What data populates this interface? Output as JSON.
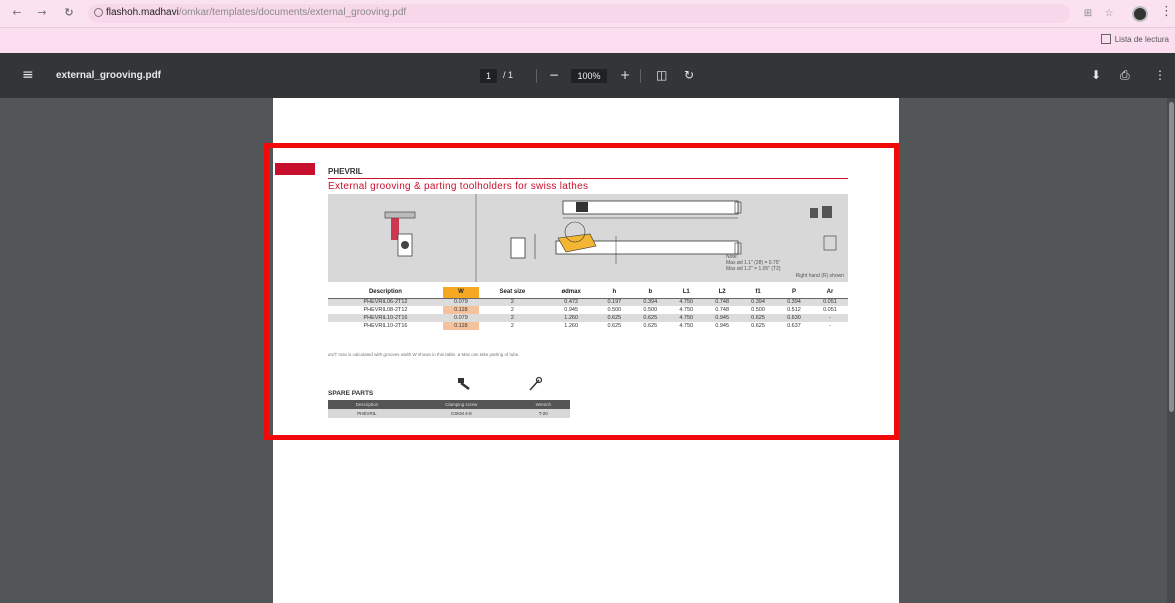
{
  "browser": {
    "url_host": "flashoh.madhavi",
    "url_path": "/omkar/templates/documents/external_grooving.pdf",
    "bookmark_label": "Lista de lectura",
    "icons": {
      "back": "back-arrow-icon",
      "forward": "forward-arrow-icon",
      "reload": "reload-icon",
      "site_info": "site-info-icon",
      "extensions": "extensions-icon",
      "star": "bookmark-star-icon",
      "profile": "profile-avatar",
      "menu": "more-vertical-icon"
    }
  },
  "pdf_toolbar": {
    "filename": "external_grooving.pdf",
    "page_current": "1",
    "page_total": "/ 1",
    "zoom": "100%",
    "zoom_out_glyph": "−",
    "zoom_in_glyph": "+",
    "fit_glyph": "◫",
    "rotate_glyph": "↻",
    "download_glyph": "⬇",
    "print_glyph": "⎙",
    "more_glyph": "⋮",
    "menu_glyph": "≡"
  },
  "document": {
    "code": "PHEVRIL",
    "title": "External grooving & parting toolholders for swiss lathes",
    "diagram_note": "Note:\nMax ød 1.1\" (28) = 0.75\"\nMax ød 1.2\" = 1.05\" (T2)",
    "diagram_footer": "Right hand (R) shown",
    "table": {
      "headers": [
        "Description",
        "W",
        "Seat size",
        "ødmax",
        "h",
        "b",
        "L1",
        "L2",
        "f1",
        "P",
        "Ar"
      ],
      "rows": [
        [
          "PHEVRIL06-2T12",
          "0.079",
          "2",
          "0.472",
          "0.197",
          "0.394",
          "4.750",
          "0.748",
          "0.394",
          "0.394",
          "0.051"
        ],
        [
          "PHEVRIL08-2T12",
          "0.118",
          "2",
          "0.945",
          "0.500",
          "0.500",
          "4.750",
          "0.748",
          "0.500",
          "0.512",
          "0.051"
        ],
        [
          "PHEVRIL10-2T16",
          "0.079",
          "2",
          "1.260",
          "0.625",
          "0.625",
          "4.750",
          "0.945",
          "0.625",
          "0.630",
          "-"
        ],
        [
          "PHEVRIL10-2T16",
          "0.118",
          "2",
          "1.260",
          "0.625",
          "0.625",
          "4.750",
          "0.945",
          "0.625",
          "0.637",
          "-"
        ]
      ]
    },
    "table_note": "ø1/T max is calculated with grooves width W shown in this table. ø Max can take parting of tube.",
    "spare_parts": {
      "title": "SPARE PARTS",
      "headers": [
        "Description",
        "Clamping screw",
        "Wrench"
      ],
      "rows": [
        [
          "PHEVRIL",
          "CSKM 4-8",
          "T-20"
        ]
      ]
    }
  },
  "highlight_color": "#f20a0a"
}
